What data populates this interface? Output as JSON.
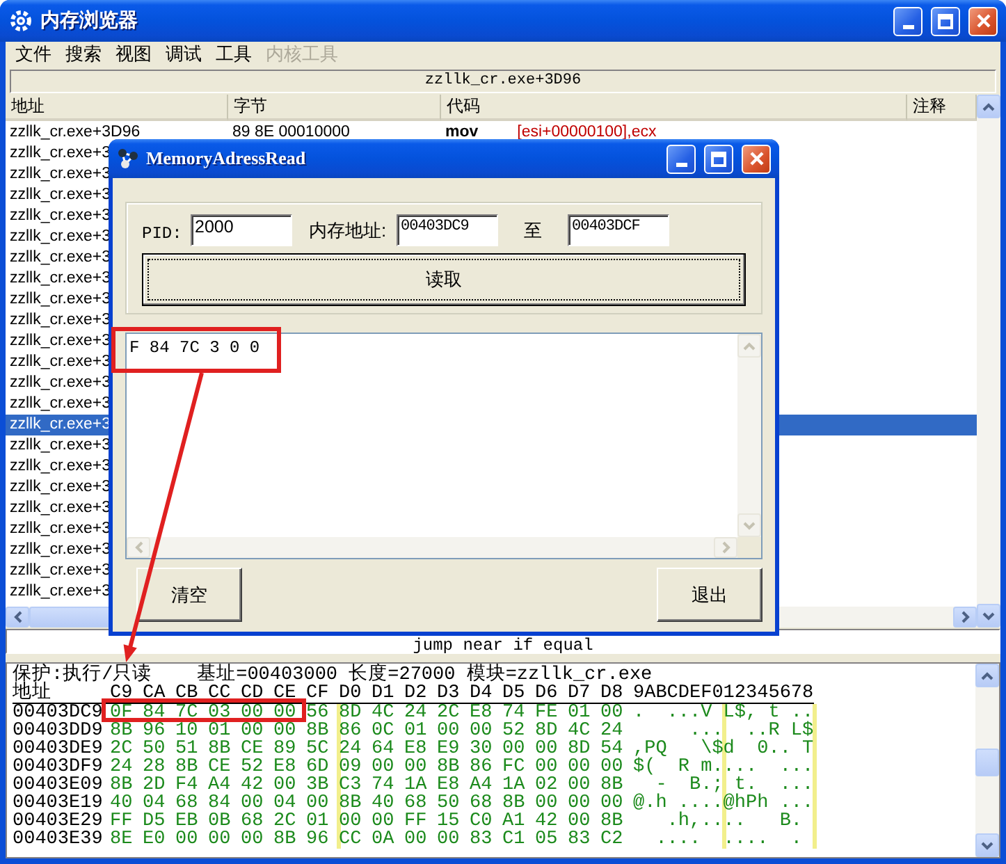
{
  "window": {
    "title": "内存浏览器"
  },
  "menu": [
    {
      "label": "文件",
      "disabled": false
    },
    {
      "label": "搜索",
      "disabled": false
    },
    {
      "label": "视图",
      "disabled": false
    },
    {
      "label": "调试",
      "disabled": false
    },
    {
      "label": "工具",
      "disabled": false
    },
    {
      "label": "内核工具",
      "disabled": true
    }
  ],
  "address_bar": {
    "value": "zzllk_cr.exe+3D96"
  },
  "disassembly": {
    "columns": [
      "地址",
      "字节",
      "代码",
      "注释"
    ],
    "rows": [
      {
        "address": "zzllk_cr.exe+3D96",
        "bytes": "89 8E 00010000",
        "opcode": "mov",
        "operand": "[esi+00000100],ecx",
        "selected": false
      },
      {
        "address": "zzllk_cr.exe+3",
        "selected": false
      },
      {
        "address": "zzllk_cr.exe+3",
        "selected": false
      },
      {
        "address": "zzllk_cr.exe+3",
        "selected": false
      },
      {
        "address": "zzllk_cr.exe+3",
        "selected": false
      },
      {
        "address": "zzllk_cr.exe+3",
        "selected": false
      },
      {
        "address": "zzllk_cr.exe+3",
        "selected": false
      },
      {
        "address": "zzllk_cr.exe+3",
        "selected": false
      },
      {
        "address": "zzllk_cr.exe+3",
        "selected": false
      },
      {
        "address": "zzllk_cr.exe+3",
        "selected": false
      },
      {
        "address": "zzllk_cr.exe+3",
        "selected": false
      },
      {
        "address": "zzllk_cr.exe+3",
        "selected": false
      },
      {
        "address": "zzllk_cr.exe+3",
        "selected": false
      },
      {
        "address": "zzllk_cr.exe+3",
        "selected": false
      },
      {
        "address": "zzllk_cr.exe+3",
        "selected": true
      },
      {
        "address": "zzllk_cr.exe+3",
        "selected": false
      },
      {
        "address": "zzllk_cr.exe+3",
        "selected": false
      },
      {
        "address": "zzllk_cr.exe+3",
        "selected": false
      },
      {
        "address": "zzllk_cr.exe+3",
        "selected": false
      },
      {
        "address": "zzllk_cr.exe+3",
        "selected": false
      },
      {
        "address": "zzllk_cr.exe+3",
        "selected": false
      },
      {
        "address": "zzllk_cr.exe+3",
        "selected": false
      },
      {
        "address": "zzllk_cr.exe+3",
        "selected": false
      }
    ]
  },
  "description": "jump near if equal",
  "hex_view": {
    "info": "保护:执行/只读    基址=00403000 长度=27000 模块=zzllk_cr.exe",
    "header": {
      "address": "地址",
      "bytes": [
        "C9",
        "CA",
        "CB",
        "CC",
        "CD",
        "CE",
        "CF",
        "D0",
        "D1",
        "D2",
        "D3",
        "D4",
        "D5",
        "D6",
        "D7",
        "D8"
      ],
      "ascii": "9ABCDEF012345678"
    },
    "rows": [
      {
        "address": "00403DC9",
        "bytes": [
          "0F",
          "84",
          "7C",
          "03",
          "00",
          "00",
          "56",
          "8D",
          "4C",
          "24",
          "2C",
          "E8",
          "74",
          "FE",
          "01",
          "00"
        ],
        "ascii": ".  ...V L$, t .."
      },
      {
        "address": "00403DD9",
        "bytes": [
          "8B",
          "96",
          "10",
          "01",
          "00",
          "00",
          "8B",
          "86",
          "0C",
          "01",
          "00",
          "00",
          "52",
          "8D",
          "4C",
          "24"
        ],
        "ascii": "     ...  ..R L$"
      },
      {
        "address": "00403DE9",
        "bytes": [
          "2C",
          "50",
          "51",
          "8B",
          "CE",
          "89",
          "5C",
          "24",
          "64",
          "E8",
          "E9",
          "30",
          "00",
          "00",
          "8D",
          "54"
        ],
        "ascii": ",PQ   \\$d  0.. T"
      },
      {
        "address": "00403DF9",
        "bytes": [
          "24",
          "28",
          "8B",
          "CE",
          "52",
          "E8",
          "6D",
          "09",
          "00",
          "00",
          "8B",
          "86",
          "FC",
          "00",
          "00",
          "00"
        ],
        "ascii": "$(  R m....  ..."
      },
      {
        "address": "00403E09",
        "bytes": [
          "8B",
          "2D",
          "F4",
          "A4",
          "42",
          "00",
          "3B",
          "C3",
          "74",
          "1A",
          "E8",
          "A4",
          "1A",
          "02",
          "00",
          "8B"
        ],
        "ascii": "  -  B.; t.  ..."
      },
      {
        "address": "00403E19",
        "bytes": [
          "40",
          "04",
          "68",
          "84",
          "00",
          "04",
          "00",
          "8B",
          "40",
          "68",
          "50",
          "68",
          "8B",
          "00",
          "00",
          "00"
        ],
        "ascii": "@.h ....@hPh ..."
      },
      {
        "address": "00403E29",
        "bytes": [
          "FF",
          "D5",
          "EB",
          "0B",
          "68",
          "2C",
          "01",
          "00",
          "00",
          "FF",
          "15",
          "C0",
          "A1",
          "42",
          "00",
          "8B"
        ],
        "ascii": "   .h,....   B."
      },
      {
        "address": "00403E39",
        "bytes": [
          "8E",
          "E0",
          "00",
          "00",
          "00",
          "8B",
          "96",
          "CC",
          "0A",
          "00",
          "00",
          "83",
          "C1",
          "05",
          "83",
          "C2"
        ],
        "ascii": "  ....  ....  ."
      }
    ]
  },
  "dialog": {
    "title": "MemoryAdressRead",
    "fields": [
      {
        "label": "PID:",
        "value": "2000"
      },
      {
        "label": "内存地址:",
        "value": "00403DC9"
      },
      {
        "label": "至",
        "value": "00403DCF"
      }
    ],
    "read_button": "读取",
    "output": "F 84 7C 3 0 0",
    "buttons": [
      "清空",
      "退出"
    ]
  },
  "annotations": [
    {
      "kind": "frame"
    },
    {
      "kind": "arrow"
    },
    {
      "kind": "frame"
    }
  ]
}
